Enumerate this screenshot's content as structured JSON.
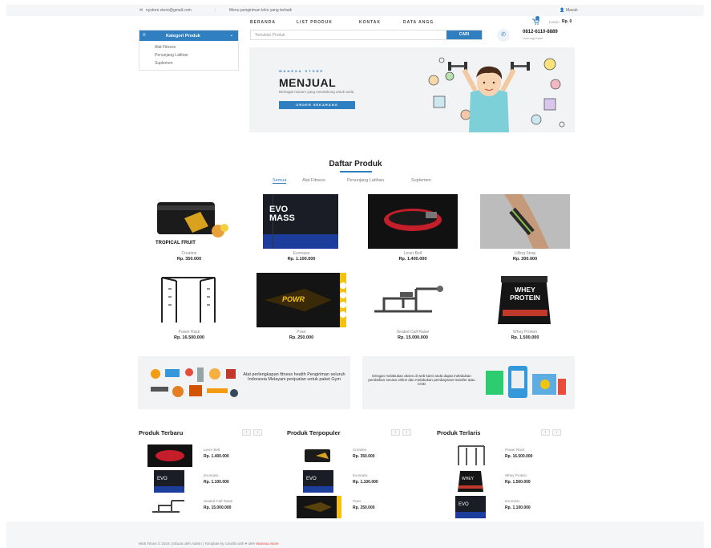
{
  "topbar": {
    "email": "nystore.store@gmail.com",
    "tagline": "Menu pengiriman toko yang terbaik",
    "account": "Masuk"
  },
  "nav": [
    "BERANDA",
    "LIST PRODUK",
    "KONTAK",
    "DATA ANGG"
  ],
  "cart": {
    "label": "Kolom",
    "total": "Rp. 0"
  },
  "phone": {
    "number": "0812-6110-8889",
    "label": "Hubungi Kami"
  },
  "category": {
    "title": "Kategori Produk",
    "items": [
      "Alat Fitness",
      "Penunjang Latihan",
      "Suplemen"
    ]
  },
  "search": {
    "placeholder": "Temukan Produk",
    "button": "CARI"
  },
  "hero": {
    "kicker": "WANESA STORE",
    "title": "MENJUAL",
    "subtitle": "Berbagai macam yang mendukung untuk anda",
    "button": "ORDER SEKARANG"
  },
  "section_title": "Daftar Produk",
  "tabs": [
    "Semua",
    "Alat Fitness",
    "Penunjang Latihan",
    "Suplemen"
  ],
  "products": [
    {
      "name": "Creatine",
      "price": "Rp. 350.000",
      "img_text": "TROPICAL FRUIT"
    },
    {
      "name": "Evomass",
      "price": "Rp. 1.100.000",
      "img_text": "EVO MASS"
    },
    {
      "name": "Lever Belt",
      "price": "Rp. 1.400.000",
      "img_text": ""
    },
    {
      "name": "Lifting Strap",
      "price": "Rp. 200.000",
      "img_text": ""
    },
    {
      "name": "Power Rack",
      "price": "Rp. 16.500.000",
      "img_text": ""
    },
    {
      "name": "Powr",
      "price": "Rp. 250.000",
      "img_text": "POWR"
    },
    {
      "name": "Seated Calf Raise",
      "price": "Rp. 15.000.000",
      "img_text": ""
    },
    {
      "name": "Whey Protein",
      "price": "Rp. 1.500.000",
      "img_text": "WHEY PROTEIN"
    }
  ],
  "banners": [
    {
      "text": "Alat perlengkapan fitness health Pengiriman seluruh Indonesia Melayani penjualan untuk paket Gym"
    },
    {
      "text": "Dengan melakukan akses di web kami anda dapat melakukan pembelian secara online dan melakukan pembayaran transfer atau COD"
    }
  ],
  "lists": [
    {
      "title": "Produk Terbaru",
      "items": [
        {
          "name": "Lever Belt",
          "price": "Rp. 1.400.000"
        },
        {
          "name": "Evomass",
          "price": "Rp. 1.100.000"
        },
        {
          "name": "Seated Calf Raise",
          "price": "Rp. 15.000.000"
        }
      ]
    },
    {
      "title": "Produk Terpopuler",
      "items": [
        {
          "name": "Creatine",
          "price": "Rp. 350.000"
        },
        {
          "name": "Evomass",
          "price": "Rp. 1.100.000"
        },
        {
          "name": "Powr",
          "price": "Rp. 250.000"
        }
      ]
    },
    {
      "title": "Produk Terlaris",
      "items": [
        {
          "name": "Power Rack",
          "price": "Rp. 16.500.000"
        },
        {
          "name": "Whey Protein",
          "price": "Rp. 1.500.000"
        },
        {
          "name": "Evomass",
          "price": "Rp. 1.100.000"
        }
      ]
    }
  ],
  "footer": {
    "text": "Web Fitnes © 2023 | Dibuat oleh Admin | Template by colorlib with ♥ oleh",
    "link": "Wanesa Store"
  },
  "colors": {
    "accent": "#2f7fc1"
  }
}
